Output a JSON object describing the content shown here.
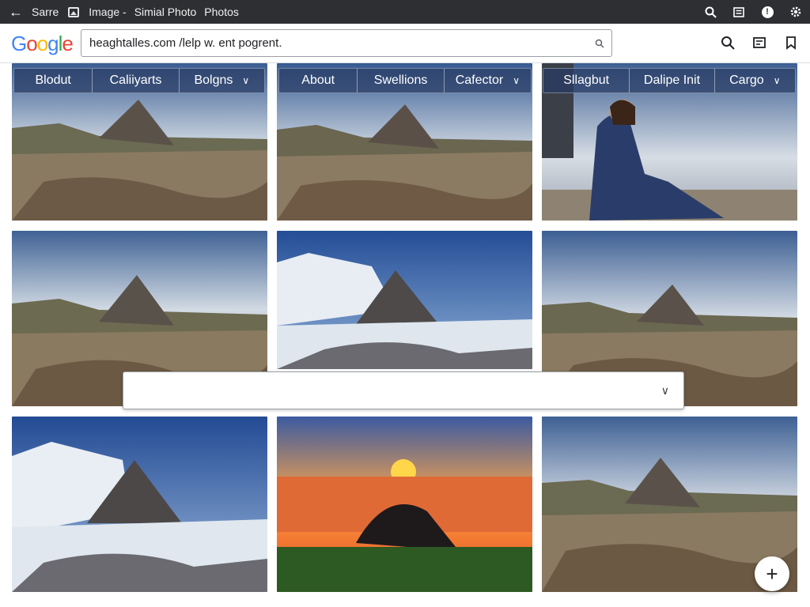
{
  "titlebar": {
    "back_icon": "arrow-left-icon",
    "items": [
      "Sarre",
      "Image -",
      "Simial Photo",
      "Photos"
    ],
    "right_icons": [
      "search-icon",
      "menu-icon",
      "info-icon",
      "gear-icon"
    ]
  },
  "header": {
    "logo": "Google",
    "search_value": "heaghtalles.com /lelp w. ent pogrent.",
    "icons": [
      "search-icon",
      "card-icon",
      "bookmark-icon"
    ]
  },
  "tabs_group_1": [
    "Blodut",
    "Caliiyarts",
    "Bolgns"
  ],
  "tabs_group_2": [
    "About",
    "Swellions",
    "Cafector"
  ],
  "tabs_group_3": [
    "Sllagbut",
    "Dalipe Init",
    "Cargo"
  ],
  "dropdown": {
    "value": ""
  },
  "fab": {
    "label": "+"
  },
  "colors": {
    "titlebar": "#2e2f33",
    "tab_overlay": "#283c64",
    "accent_blue": "#4285f4"
  }
}
